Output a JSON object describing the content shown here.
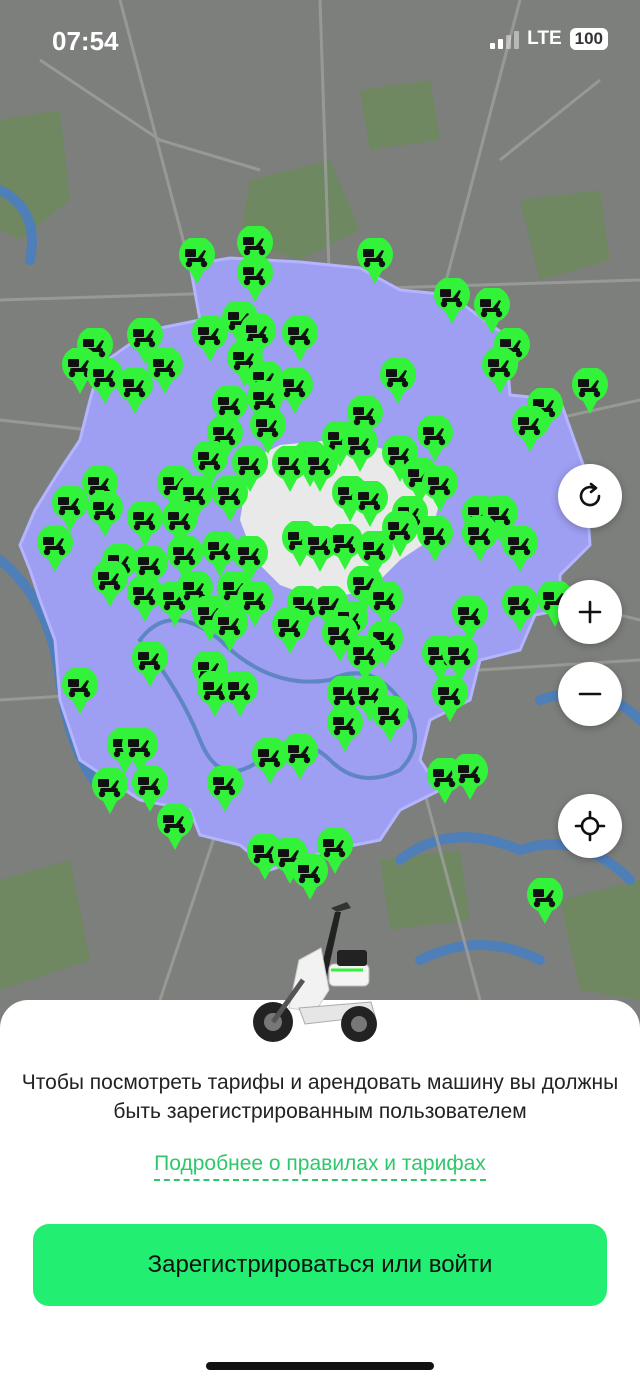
{
  "status_bar": {
    "time": "07:54",
    "network": "LTE",
    "battery": "100"
  },
  "map": {
    "colors": {
      "land": "#7d7f7c",
      "zone": "#9e9ef2",
      "zone_border": "#b4b4ff",
      "center": "#e9e9e9",
      "water": "#4f7fb8",
      "park": "#6c8a5e",
      "marker": "#33f23a"
    },
    "controls": [
      {
        "name": "refresh-button",
        "icon": "refresh-icon"
      },
      {
        "name": "zoom-in-button",
        "icon": "plus-icon"
      },
      {
        "name": "zoom-out-button",
        "icon": "minus-icon"
      },
      {
        "name": "locate-button",
        "icon": "crosshair-icon"
      }
    ]
  },
  "sheet": {
    "message": "Чтобы посмотреть тарифы и арендовать машину вы должны быть зарегистрированным пользователем",
    "link": "Подробнее о правилах и тарифах",
    "cta": "Зарегистрироваться или войти"
  }
}
